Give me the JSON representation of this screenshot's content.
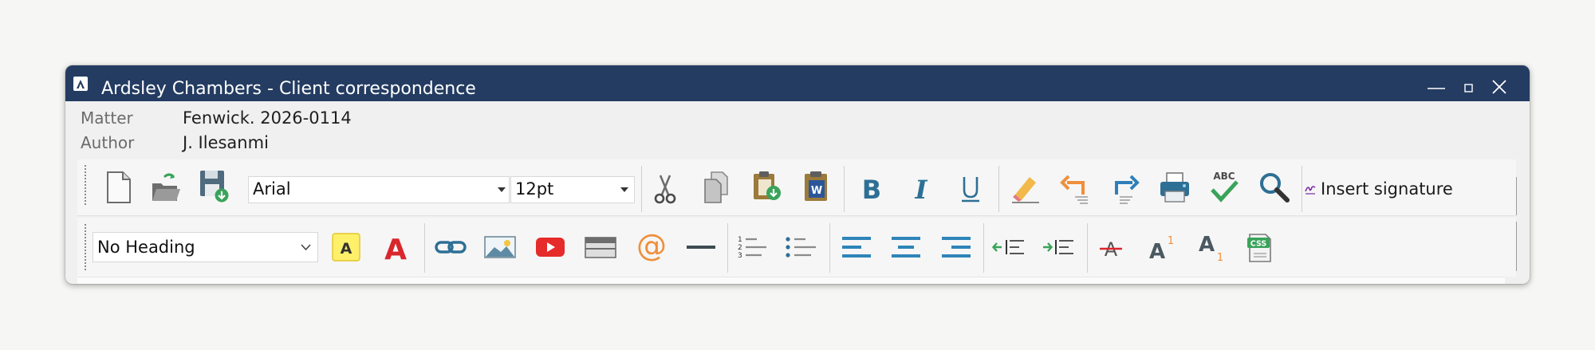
{
  "window": {
    "title": "Ardsley Chambers - Client correspondence",
    "title_bar_color": "#243c62"
  },
  "meta": {
    "matter_label": "Matter",
    "matter_value": "Fenwick. 2026-0114",
    "author_label": "Author",
    "author_value": "J. Ilesanmi"
  },
  "toolbar_top": {
    "buttons": [
      "new-document-icon",
      "open-folder-icon",
      "save-icon"
    ],
    "font_family": "Arial",
    "font_size": "12pt",
    "edit_buttons": [
      "cut-icon",
      "copy-icon",
      "paste-icon",
      "paste-from-word-icon"
    ],
    "format_buttons": [
      "bold-icon",
      "italic-icon",
      "underline-icon"
    ],
    "tool_buttons": [
      "eraser-icon",
      "undo-icon",
      "redo-icon",
      "print-icon",
      "spell-check-icon",
      "find-icon"
    ],
    "insert_signature_label": "Insert signature",
    "accent_color": "#2e9bc8"
  },
  "toolbar_bottom": {
    "heading_select": "No Heading",
    "buttons": [
      "highlight-color-icon",
      "font-color-icon",
      "link-icon",
      "image-icon",
      "video-icon",
      "table-icon",
      "email-icon",
      "horizontal-rule-icon",
      "numbered-list-icon",
      "bulleted-list-icon",
      "align-left-icon",
      "align-center-icon",
      "align-right-icon",
      "outdent-icon",
      "indent-icon",
      "strikethrough-icon",
      "superscript-icon",
      "subscript-icon",
      "css-icon"
    ]
  }
}
